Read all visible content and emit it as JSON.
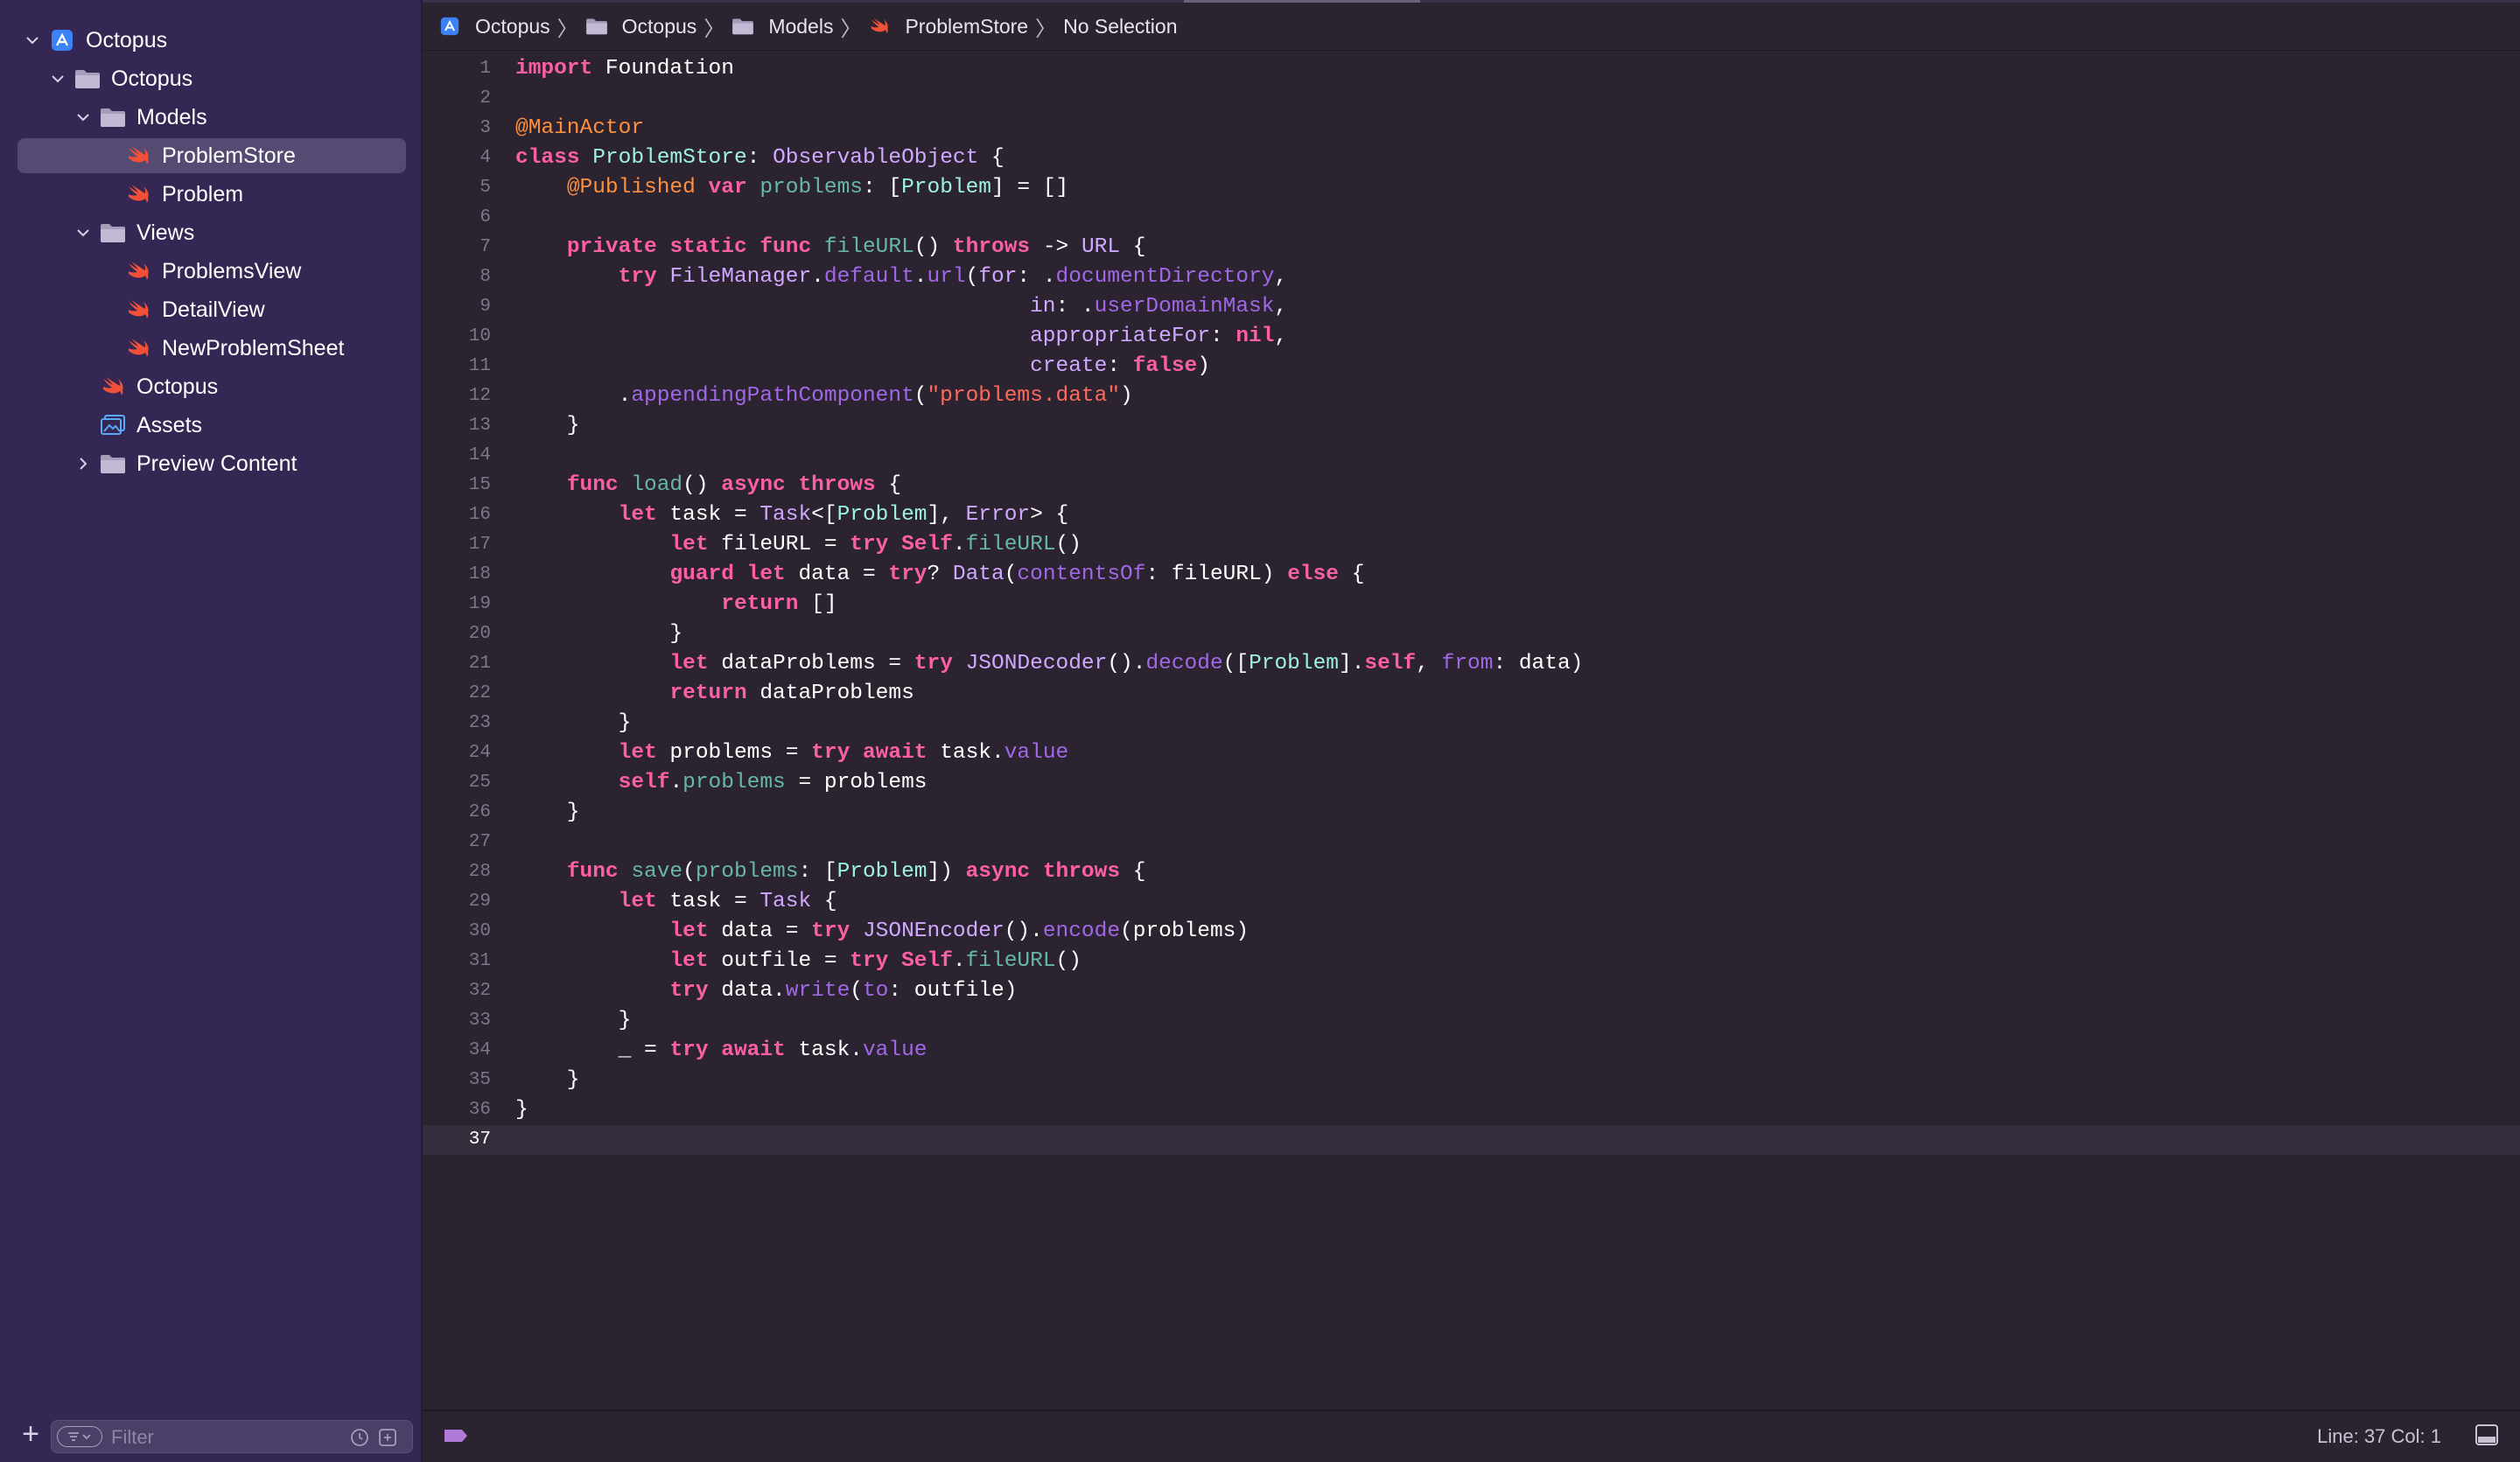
{
  "navigator": {
    "items": [
      {
        "label": "Octopus",
        "icon": "project-icon",
        "depth": 0,
        "disclosure": "expanded",
        "selected": false
      },
      {
        "label": "Octopus",
        "icon": "folder-icon",
        "depth": 1,
        "disclosure": "expanded",
        "selected": false
      },
      {
        "label": "Models",
        "icon": "folder-icon",
        "depth": 2,
        "disclosure": "expanded",
        "selected": false
      },
      {
        "label": "ProblemStore",
        "icon": "swift-file-icon",
        "depth": 3,
        "disclosure": "none",
        "selected": true
      },
      {
        "label": "Problem",
        "icon": "swift-file-icon",
        "depth": 3,
        "disclosure": "none",
        "selected": false
      },
      {
        "label": "Views",
        "icon": "folder-icon",
        "depth": 2,
        "disclosure": "expanded",
        "selected": false
      },
      {
        "label": "ProblemsView",
        "icon": "swift-file-icon",
        "depth": 3,
        "disclosure": "none",
        "selected": false
      },
      {
        "label": "DetailView",
        "icon": "swift-file-icon",
        "depth": 3,
        "disclosure": "none",
        "selected": false
      },
      {
        "label": "NewProblemSheet",
        "icon": "swift-file-icon",
        "depth": 3,
        "disclosure": "none",
        "selected": false
      },
      {
        "label": "Octopus",
        "icon": "swift-file-icon",
        "depth": 2,
        "disclosure": "none",
        "selected": false
      },
      {
        "label": "Assets",
        "icon": "asset-catalog-icon",
        "depth": 2,
        "disclosure": "none",
        "selected": false
      },
      {
        "label": "Preview Content",
        "icon": "folder-icon",
        "depth": 2,
        "disclosure": "collapsed",
        "selected": false
      }
    ],
    "filter_placeholder": "Filter",
    "add_label": "+"
  },
  "jumpbar": {
    "crumbs": [
      {
        "label": "Octopus",
        "icon": "project-icon"
      },
      {
        "label": "Octopus",
        "icon": "folder-icon"
      },
      {
        "label": "Models",
        "icon": "folder-icon"
      },
      {
        "label": "ProblemStore",
        "icon": "swift-file-icon"
      },
      {
        "label": "No Selection",
        "icon": ""
      }
    ],
    "separator": "〉"
  },
  "editor": {
    "current_line": 37,
    "lines": [
      [
        [
          "k",
          "import"
        ],
        [
          "p",
          " Foundation"
        ]
      ],
      [],
      [
        [
          "at",
          "@MainActor"
        ]
      ],
      [
        [
          "k",
          "class"
        ],
        [
          "p",
          " "
        ],
        [
          "cty",
          "ProblemStore"
        ],
        [
          "p",
          ": "
        ],
        [
          "ty",
          "ObservableObject"
        ],
        [
          "p",
          " {"
        ]
      ],
      [
        [
          "p",
          "    "
        ],
        [
          "at",
          "@Published"
        ],
        [
          "p",
          " "
        ],
        [
          "k",
          "var"
        ],
        [
          "p",
          " "
        ],
        [
          "vr",
          "problems"
        ],
        [
          "p",
          ": ["
        ],
        [
          "cty",
          "Problem"
        ],
        [
          "p",
          "] = []"
        ]
      ],
      [],
      [
        [
          "p",
          "    "
        ],
        [
          "k",
          "private"
        ],
        [
          "p",
          " "
        ],
        [
          "k",
          "static"
        ],
        [
          "p",
          " "
        ],
        [
          "k",
          "func"
        ],
        [
          "p",
          " "
        ],
        [
          "vr",
          "fileURL"
        ],
        [
          "p",
          "() "
        ],
        [
          "k",
          "throws"
        ],
        [
          "p",
          " -> "
        ],
        [
          "ty",
          "URL"
        ],
        [
          "p",
          " {"
        ]
      ],
      [
        [
          "p",
          "        "
        ],
        [
          "k",
          "try"
        ],
        [
          "p",
          " "
        ],
        [
          "ty",
          "FileManager"
        ],
        [
          "p",
          "."
        ],
        [
          "fn",
          "default"
        ],
        [
          "p",
          "."
        ],
        [
          "fn",
          "url"
        ],
        [
          "p",
          "("
        ],
        [
          "am",
          "for"
        ],
        [
          "p",
          ": ."
        ],
        [
          "fn",
          "documentDirectory"
        ],
        [
          "p",
          ","
        ]
      ],
      [
        [
          "p",
          "                                        "
        ],
        [
          "am",
          "in"
        ],
        [
          "p",
          ": ."
        ],
        [
          "fn",
          "userDomainMask"
        ],
        [
          "p",
          ","
        ]
      ],
      [
        [
          "p",
          "                                        "
        ],
        [
          "am",
          "appropriateFor"
        ],
        [
          "p",
          ": "
        ],
        [
          "k",
          "nil"
        ],
        [
          "p",
          ","
        ]
      ],
      [
        [
          "p",
          "                                        "
        ],
        [
          "am",
          "create"
        ],
        [
          "p",
          ": "
        ],
        [
          "k",
          "false"
        ],
        [
          "p",
          ")"
        ]
      ],
      [
        [
          "p",
          "        ."
        ],
        [
          "fn",
          "appendingPathComponent"
        ],
        [
          "p",
          "("
        ],
        [
          "st",
          "\"problems.data\""
        ],
        [
          "p",
          ")"
        ]
      ],
      [
        [
          "p",
          "    }"
        ]
      ],
      [],
      [
        [
          "p",
          "    "
        ],
        [
          "k",
          "func"
        ],
        [
          "p",
          " "
        ],
        [
          "vr",
          "load"
        ],
        [
          "p",
          "() "
        ],
        [
          "k",
          "async"
        ],
        [
          "p",
          " "
        ],
        [
          "k",
          "throws"
        ],
        [
          "p",
          " {"
        ]
      ],
      [
        [
          "p",
          "        "
        ],
        [
          "k",
          "let"
        ],
        [
          "p",
          " task = "
        ],
        [
          "ty",
          "Task"
        ],
        [
          "p",
          "<["
        ],
        [
          "cty",
          "Problem"
        ],
        [
          "p",
          "], "
        ],
        [
          "ty",
          "Error"
        ],
        [
          "p",
          "> {"
        ]
      ],
      [
        [
          "p",
          "            "
        ],
        [
          "k",
          "let"
        ],
        [
          "p",
          " fileURL = "
        ],
        [
          "k",
          "try"
        ],
        [
          "p",
          " "
        ],
        [
          "k",
          "Self"
        ],
        [
          "p",
          "."
        ],
        [
          "vr",
          "fileURL"
        ],
        [
          "p",
          "()"
        ]
      ],
      [
        [
          "p",
          "            "
        ],
        [
          "k",
          "guard"
        ],
        [
          "p",
          " "
        ],
        [
          "k",
          "let"
        ],
        [
          "p",
          " data = "
        ],
        [
          "k",
          "try"
        ],
        [
          "p",
          "? "
        ],
        [
          "ty",
          "Data"
        ],
        [
          "p",
          "("
        ],
        [
          "fn",
          "contentsOf"
        ],
        [
          "p",
          ": fileURL) "
        ],
        [
          "k",
          "else"
        ],
        [
          "p",
          " {"
        ]
      ],
      [
        [
          "p",
          "                "
        ],
        [
          "k",
          "return"
        ],
        [
          "p",
          " []"
        ]
      ],
      [
        [
          "p",
          "            }"
        ]
      ],
      [
        [
          "p",
          "            "
        ],
        [
          "k",
          "let"
        ],
        [
          "p",
          " dataProblems = "
        ],
        [
          "k",
          "try"
        ],
        [
          "p",
          " "
        ],
        [
          "ty",
          "JSONDecoder"
        ],
        [
          "p",
          "()."
        ],
        [
          "fn",
          "decode"
        ],
        [
          "p",
          "(["
        ],
        [
          "cty",
          "Problem"
        ],
        [
          "p",
          "]."
        ],
        [
          "k",
          "self"
        ],
        [
          "p",
          ", "
        ],
        [
          "fn",
          "from"
        ],
        [
          "p",
          ": data)"
        ]
      ],
      [
        [
          "p",
          "            "
        ],
        [
          "k",
          "return"
        ],
        [
          "p",
          " dataProblems"
        ]
      ],
      [
        [
          "p",
          "        }"
        ]
      ],
      [
        [
          "p",
          "        "
        ],
        [
          "k",
          "let"
        ],
        [
          "p",
          " problems = "
        ],
        [
          "k",
          "try"
        ],
        [
          "p",
          " "
        ],
        [
          "k",
          "await"
        ],
        [
          "p",
          " task."
        ],
        [
          "fn",
          "value"
        ]
      ],
      [
        [
          "p",
          "        "
        ],
        [
          "k",
          "self"
        ],
        [
          "p",
          "."
        ],
        [
          "vr",
          "problems"
        ],
        [
          "p",
          " = problems"
        ]
      ],
      [
        [
          "p",
          "    }"
        ]
      ],
      [],
      [
        [
          "p",
          "    "
        ],
        [
          "k",
          "func"
        ],
        [
          "p",
          " "
        ],
        [
          "vr",
          "save"
        ],
        [
          "p",
          "("
        ],
        [
          "vr",
          "problems"
        ],
        [
          "p",
          ": ["
        ],
        [
          "cty",
          "Problem"
        ],
        [
          "p",
          "]) "
        ],
        [
          "k",
          "async"
        ],
        [
          "p",
          " "
        ],
        [
          "k",
          "throws"
        ],
        [
          "p",
          " {"
        ]
      ],
      [
        [
          "p",
          "        "
        ],
        [
          "k",
          "let"
        ],
        [
          "p",
          " task = "
        ],
        [
          "ty",
          "Task"
        ],
        [
          "p",
          " {"
        ]
      ],
      [
        [
          "p",
          "            "
        ],
        [
          "k",
          "let"
        ],
        [
          "p",
          " data = "
        ],
        [
          "k",
          "try"
        ],
        [
          "p",
          " "
        ],
        [
          "ty",
          "JSONEncoder"
        ],
        [
          "p",
          "()."
        ],
        [
          "fn",
          "encode"
        ],
        [
          "p",
          "(problems)"
        ]
      ],
      [
        [
          "p",
          "            "
        ],
        [
          "k",
          "let"
        ],
        [
          "p",
          " outfile = "
        ],
        [
          "k",
          "try"
        ],
        [
          "p",
          " "
        ],
        [
          "k",
          "Self"
        ],
        [
          "p",
          "."
        ],
        [
          "vr",
          "fileURL"
        ],
        [
          "p",
          "()"
        ]
      ],
      [
        [
          "p",
          "            "
        ],
        [
          "k",
          "try"
        ],
        [
          "p",
          " data."
        ],
        [
          "fn",
          "write"
        ],
        [
          "p",
          "("
        ],
        [
          "fn",
          "to"
        ],
        [
          "p",
          ": outfile)"
        ]
      ],
      [
        [
          "p",
          "        }"
        ]
      ],
      [
        [
          "p",
          "        _ = "
        ],
        [
          "k",
          "try"
        ],
        [
          "p",
          " "
        ],
        [
          "k",
          "await"
        ],
        [
          "p",
          " task."
        ],
        [
          "fn",
          "value"
        ]
      ],
      [
        [
          "p",
          "    }"
        ]
      ],
      [
        [
          "p",
          "}"
        ]
      ],
      []
    ]
  },
  "status": {
    "cursor": "Line: 37  Col: 1"
  },
  "colors": {
    "sidebar_bg": "#342754",
    "editor_bg": "#2b2430",
    "keyword": "#fc5fa3",
    "string": "#fc6a5d",
    "attribute": "#fd8f3f",
    "swift_icon": "#f05138"
  }
}
